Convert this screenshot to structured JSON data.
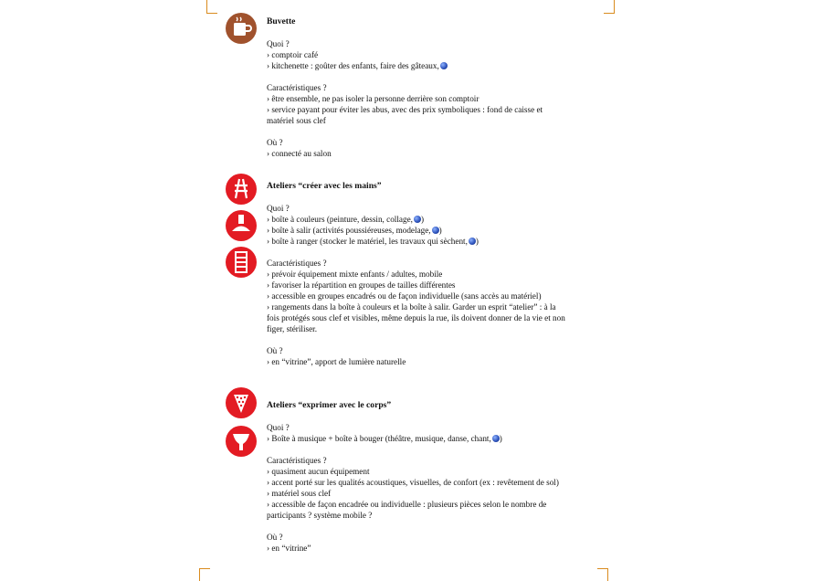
{
  "sections": [
    {
      "title": "Buvette",
      "quoi_label": "Quoi ?",
      "quoi": [
        "› comptoir café",
        "› kitchenette : goûter des enfants, faire des gâteaux,"
      ],
      "car_label": "Caractéristiques ?",
      "car": [
        "› être ensemble, ne pas isoler la personne derrière son comptoir",
        "› service payant pour éviter les abus, avec des prix symboliques : fond de caisse et matériel sous clef"
      ],
      "ou_label": "Où ?",
      "ou": [
        "› connecté au salon"
      ]
    },
    {
      "title": "Ateliers  “créer avec les mains”",
      "quoi_label": "Quoi ?",
      "quoi": [
        "› boîte à couleurs (peinture, dessin, collage,",
        "› boîte à salir (activités poussiéreuses, modelage,",
        "› boîte à ranger (stocker le matériel, les travaux qui sèchent,"
      ],
      "car_label": "Caractéristiques ?",
      "car": [
        "› prévoir équipement mixte enfants / adultes, mobile",
        "› favoriser la répartition en groupes de tailles différentes",
        "› accessible en groupes encadrés ou de façon individuelle (sans accès au matériel)",
        "› rangements dans la boîte à couleurs et la boîte à salir. Garder un esprit “atelier” : à la fois protégés sous clef et visibles, même depuis la rue, ils doivent donner de la vie et non figer, stériliser."
      ],
      "ou_label": "Où ?",
      "ou": [
        "› en “vitrine”, apport de lumière naturelle"
      ]
    },
    {
      "title": "Ateliers “exprimer avec le corps”",
      "quoi_label": "Quoi ?",
      "quoi": [
        "› Boîte à musique + boîte à bouger (théâtre, musique, danse, chant,"
      ],
      "car_label": "Caractéristiques ?",
      "car": [
        "› quasiment aucun équipement",
        "› accent porté sur les qualités acoustiques, visuelles, de confort (ex : revêtement de sol)",
        "› matériel sous clef",
        "› accessible de façon encadrée ou individuelle : plusieurs pièces selon le nombre de participants ? système mobile ?"
      ],
      "ou_label": "Où ?",
      "ou": [
        "› en “vitrine”"
      ]
    }
  ],
  "closing_paren": ")",
  "icons": {
    "buvette": "coffee-cup-icon",
    "atelier1": "easel-icon",
    "atelier2": "lamp-icon",
    "atelier3": "shelf-icon",
    "corps1": "microphone-icon",
    "corps2": "drum-icon"
  },
  "colors": {
    "brown": "#a0522d",
    "red": "#e31b23",
    "crop": "#d98b1e",
    "dot": "#2a4fb8"
  }
}
